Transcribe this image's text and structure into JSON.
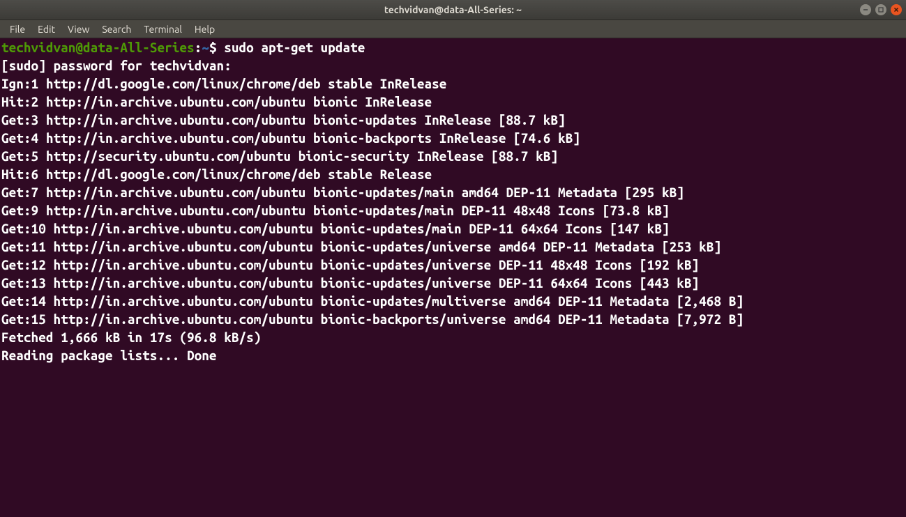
{
  "window": {
    "title": "techvidvan@data-All-Series: ~"
  },
  "menu": {
    "file": "File",
    "edit": "Edit",
    "view": "View",
    "search": "Search",
    "terminal": "Terminal",
    "help": "Help"
  },
  "prompt": {
    "userhost": "techvidvan@data-All-Series",
    "sep": ":",
    "path": "~",
    "symbol": "$ "
  },
  "command": "sudo apt-get update",
  "lines": {
    "l0": "[sudo] password for techvidvan: ",
    "l1": "Ign:1 http://dl.google.com/linux/chrome/deb stable InRelease",
    "l2": "Hit:2 http://in.archive.ubuntu.com/ubuntu bionic InRelease",
    "l3": "Get:3 http://in.archive.ubuntu.com/ubuntu bionic-updates InRelease [88.7 kB]",
    "l4": "Get:4 http://in.archive.ubuntu.com/ubuntu bionic-backports InRelease [74.6 kB]",
    "l5": "Get:5 http://security.ubuntu.com/ubuntu bionic-security InRelease [88.7 kB]",
    "l6": "Hit:6 http://dl.google.com/linux/chrome/deb stable Release",
    "l7": "Get:7 http://in.archive.ubuntu.com/ubuntu bionic-updates/main amd64 DEP-11 Metadata [295 kB]",
    "l8": "Get:9 http://in.archive.ubuntu.com/ubuntu bionic-updates/main DEP-11 48x48 Icons [73.8 kB]",
    "l9": "Get:10 http://in.archive.ubuntu.com/ubuntu bionic-updates/main DEP-11 64x64 Icons [147 kB]",
    "l10": "Get:11 http://in.archive.ubuntu.com/ubuntu bionic-updates/universe amd64 DEP-11 Metadata [253 kB]",
    "l11": "Get:12 http://in.archive.ubuntu.com/ubuntu bionic-updates/universe DEP-11 48x48 Icons [192 kB]",
    "l12": "Get:13 http://in.archive.ubuntu.com/ubuntu bionic-updates/universe DEP-11 64x64 Icons [443 kB]",
    "l13": "Get:14 http://in.archive.ubuntu.com/ubuntu bionic-updates/multiverse amd64 DEP-11 Metadata [2,468 B]",
    "l14": "Get:15 http://in.archive.ubuntu.com/ubuntu bionic-backports/universe amd64 DEP-11 Metadata [7,972 B]",
    "l15": "Fetched 1,666 kB in 17s (96.8 kB/s)",
    "l16": "Reading package lists... Done"
  }
}
